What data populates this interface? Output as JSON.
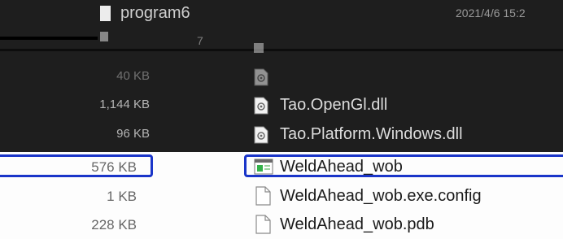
{
  "top_folder": {
    "name": "program6",
    "date": "2021/4/6 15:2"
  },
  "rows": [
    {
      "size": "",
      "name": "7",
      "type": "dll",
      "faded": true
    },
    {
      "size": "40 KB",
      "name": "",
      "type": "dll",
      "faded": true
    },
    {
      "size": "1,144 KB",
      "name": "Tao.OpenGl.dll",
      "type": "dll",
      "faded": false
    },
    {
      "size": "96 KB",
      "name": "Tao.Platform.Windows.dll",
      "type": "dll",
      "faded": false
    },
    {
      "size": "576 KB",
      "name": "WeldAhead_wob",
      "type": "exe",
      "selected": true
    },
    {
      "size": "1 KB",
      "name": "WeldAhead_wob.exe.config",
      "type": "file"
    },
    {
      "size": "228 KB",
      "name": "WeldAhead_wob.pdb",
      "type": "file"
    }
  ],
  "colors": {
    "dark_bg": "#1e1e1e",
    "light_bg": "#fdfdfd",
    "highlight": "#1a35c9"
  }
}
